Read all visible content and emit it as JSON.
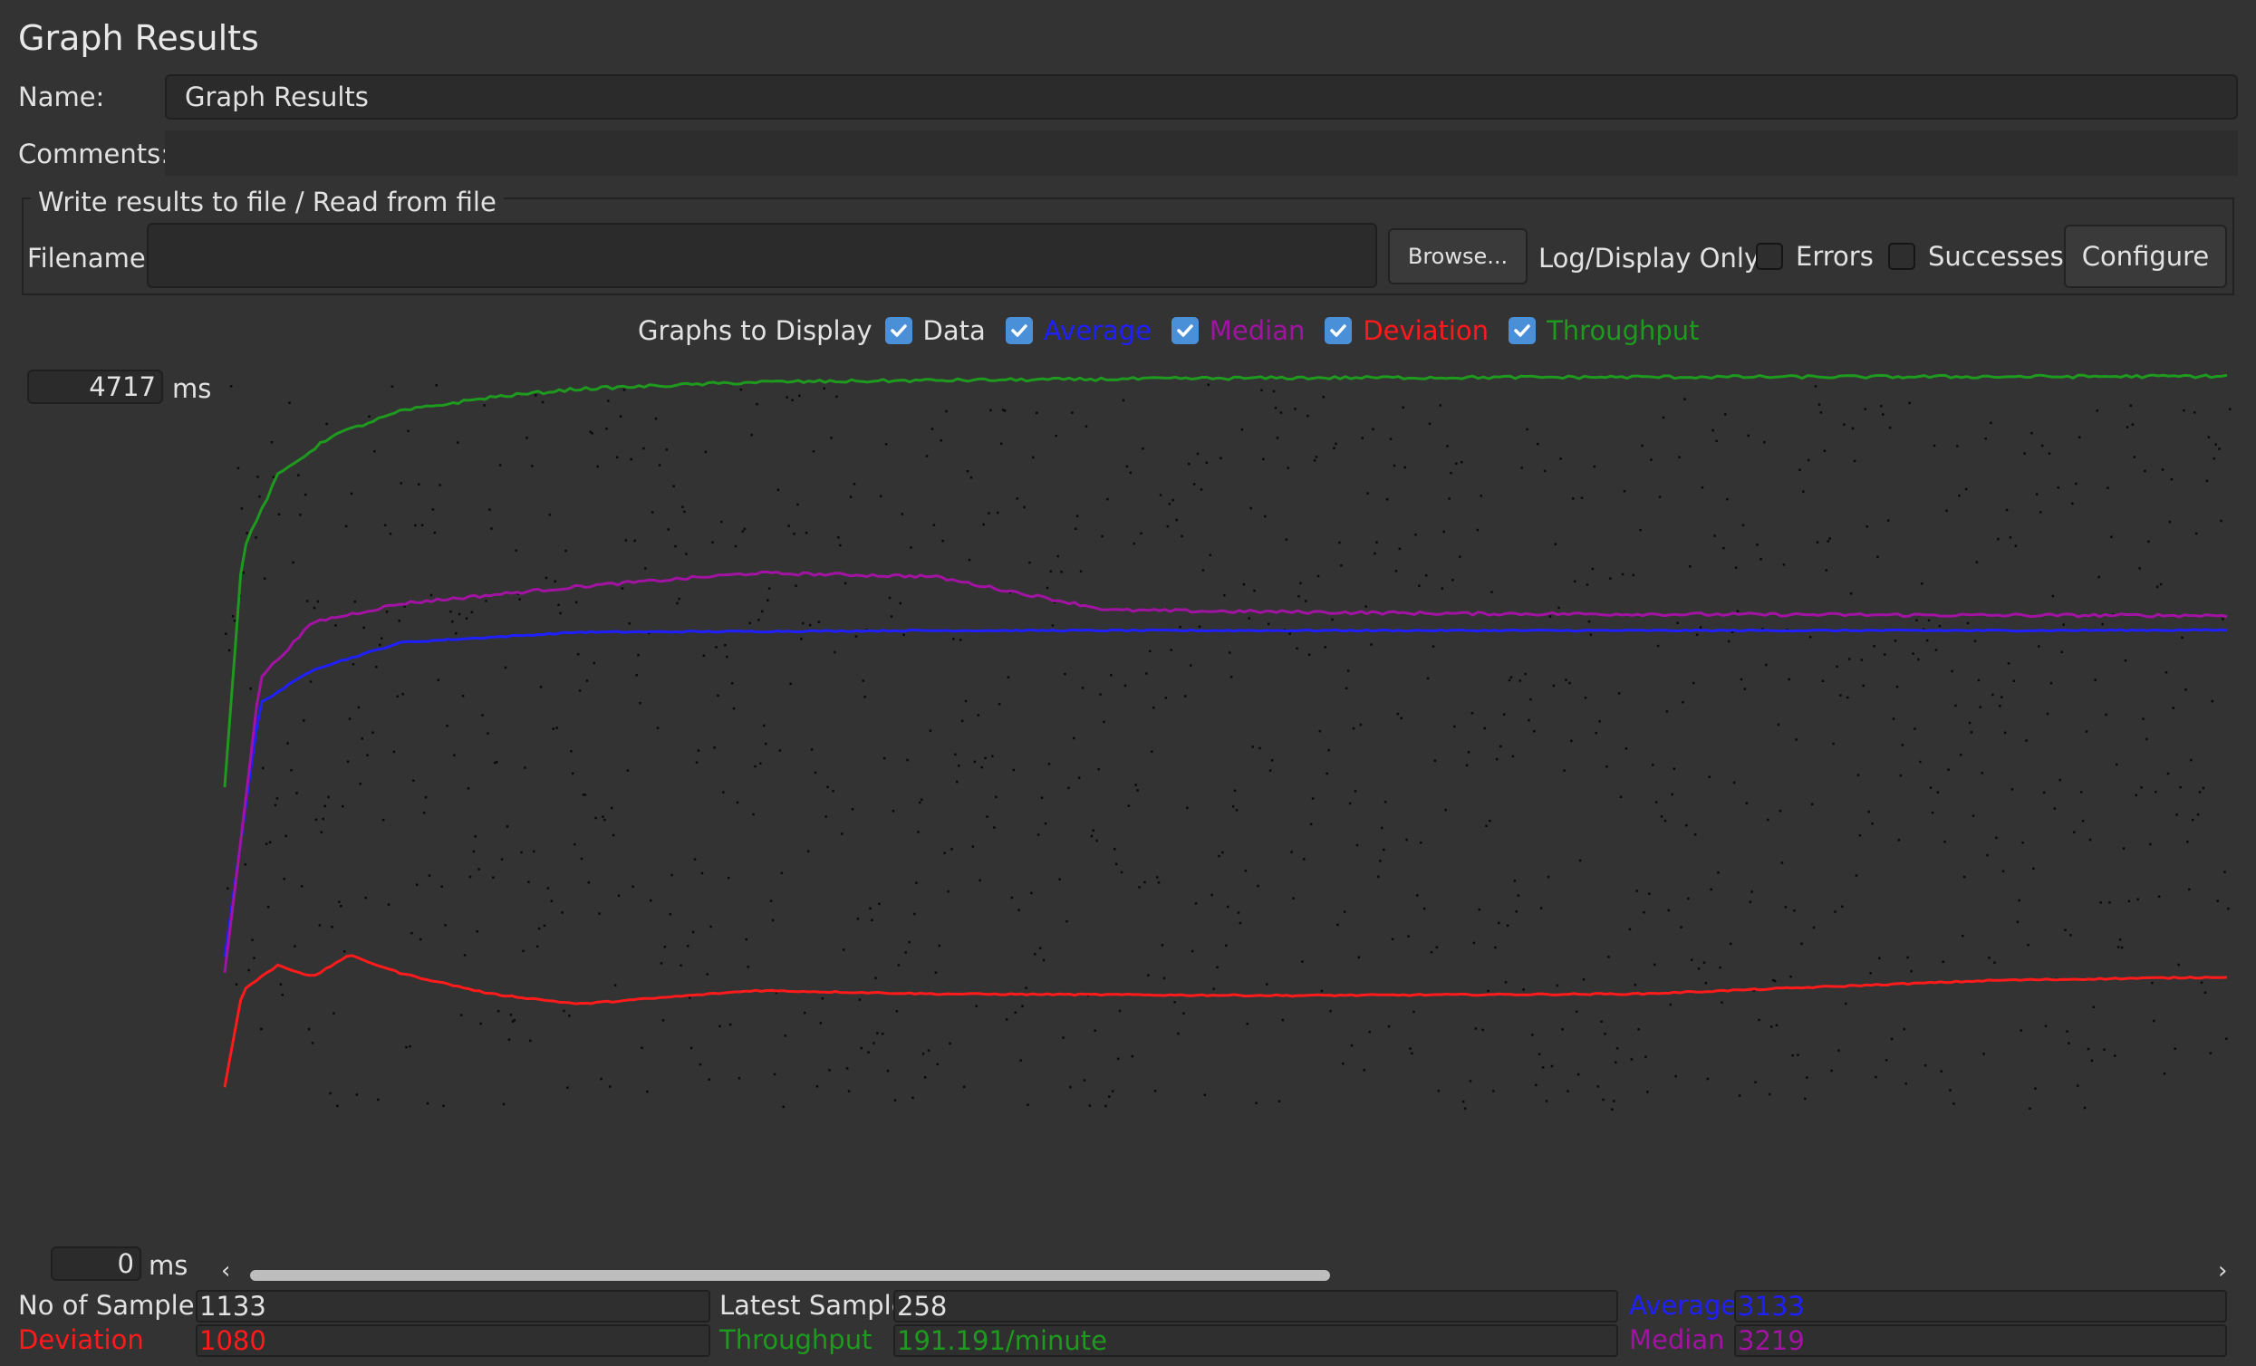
{
  "title": "Graph Results",
  "name_label": "Name:",
  "name_value": "Graph Results",
  "comments_label": "Comments:",
  "comments_value": "",
  "file_group": {
    "legend": "Write results to file / Read from file",
    "filename_label": "Filename",
    "filename_value": "",
    "browse_label": "Browse...",
    "log_display_label": "Log/Display Only:",
    "errors_label": "Errors",
    "successes_label": "Successes",
    "configure_label": "Configure"
  },
  "graphs": {
    "label": "Graphs to Display",
    "options": [
      {
        "label": "Data",
        "color": "#e2e2e2",
        "checked": true
      },
      {
        "label": "Average",
        "color": "#1f1fff",
        "checked": true
      },
      {
        "label": "Median",
        "color": "#a313a3",
        "checked": true
      },
      {
        "label": "Deviation",
        "color": "#ff1b1b",
        "checked": true
      },
      {
        "label": "Throughput",
        "color": "#1e9a1e",
        "checked": true
      }
    ]
  },
  "scale": {
    "max": "4717",
    "min": "0",
    "unit": "ms"
  },
  "stats": {
    "no_of_samples_label": "No of Samples",
    "no_of_samples": "1133",
    "latest_sample_label": "Latest Sample",
    "latest_sample": "258",
    "average_label": "Average",
    "average": "3133",
    "deviation_label": "Deviation",
    "deviation": "1080",
    "throughput_label": "Throughput",
    "throughput": "191.191/minute",
    "median_label": "Median",
    "median": "3219"
  },
  "colors": {
    "average": "#1f1fff",
    "median": "#a313a3",
    "deviation": "#ff1b1b",
    "throughput": "#1e9a1e",
    "data": "#0a0a0a",
    "check_accent": "#4a90d9"
  },
  "chart_data": {
    "type": "line",
    "title": "",
    "xlabel": "",
    "ylabel": "ms",
    "ylim": [
      0,
      4717
    ],
    "samples": 1133,
    "series": [
      {
        "name": "Average",
        "x": [
          0,
          20,
          50,
          100,
          200,
          400,
          700,
          1000,
          1133
        ],
        "values": [
          1200,
          2700,
          2900,
          3060,
          3120,
          3130,
          3130,
          3130,
          3133
        ]
      },
      {
        "name": "Median",
        "x": [
          0,
          20,
          50,
          100,
          200,
          300,
          400,
          500,
          700,
          1000,
          1133
        ],
        "values": [
          1100,
          2850,
          3180,
          3290,
          3390,
          3470,
          3450,
          3250,
          3230,
          3220,
          3219
        ]
      },
      {
        "name": "Deviation",
        "x": [
          0,
          10,
          30,
          50,
          70,
          100,
          150,
          200,
          300,
          400,
          600,
          800,
          1000,
          1133
        ],
        "values": [
          430,
          1000,
          1150,
          1080,
          1210,
          1100,
          980,
          920,
          1000,
          980,
          970,
          980,
          1060,
          1080
        ]
      },
      {
        "name": "Throughput",
        "x": [
          0,
          10,
          30,
          60,
          100,
          150,
          200,
          300,
          400,
          600,
          800,
          1000,
          1133
        ],
        "values": [
          2200,
          3600,
          4050,
          4280,
          4430,
          4510,
          4560,
          4600,
          4610,
          4625,
          4630,
          4632,
          4635
        ]
      }
    ]
  }
}
